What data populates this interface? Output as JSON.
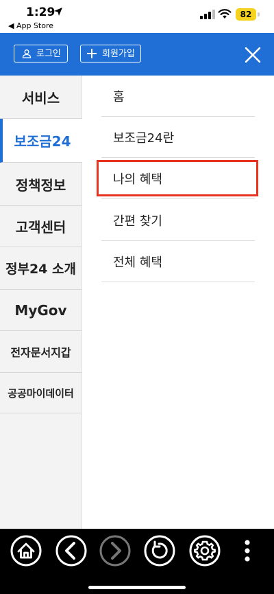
{
  "status_bar": {
    "time": "1:29",
    "back_app": "◀ App Store",
    "battery": "82",
    "icons": [
      "location-arrow-icon",
      "signal-icon",
      "wifi-icon",
      "battery-icon"
    ]
  },
  "header": {
    "login_label": "로그인",
    "join_label": "회원가입",
    "accent_color": "#1f6fd6"
  },
  "left_nav": {
    "items": [
      {
        "label": "서비스",
        "active": false
      },
      {
        "label": "보조금24",
        "active": true
      },
      {
        "label": "정책정보",
        "active": false
      },
      {
        "label": "고객센터",
        "active": false
      },
      {
        "label": "정부24 소개",
        "active": false
      },
      {
        "label": "MyGov",
        "active": false
      },
      {
        "label": "전자문서지갑",
        "active": false
      },
      {
        "label": "공공마이데이터",
        "active": false
      }
    ]
  },
  "sub_nav": {
    "items": [
      {
        "label": "홈"
      },
      {
        "label": "보조금24란"
      },
      {
        "label": "나의 혜택",
        "highlighted": true
      },
      {
        "label": "간편 찾기"
      },
      {
        "label": "전체 혜택"
      }
    ],
    "highlight_color": "#e7331f"
  },
  "toolbar": {
    "icons": [
      "home-icon",
      "back-icon",
      "forward-icon",
      "refresh-icon",
      "settings-icon",
      "more-icon"
    ]
  }
}
